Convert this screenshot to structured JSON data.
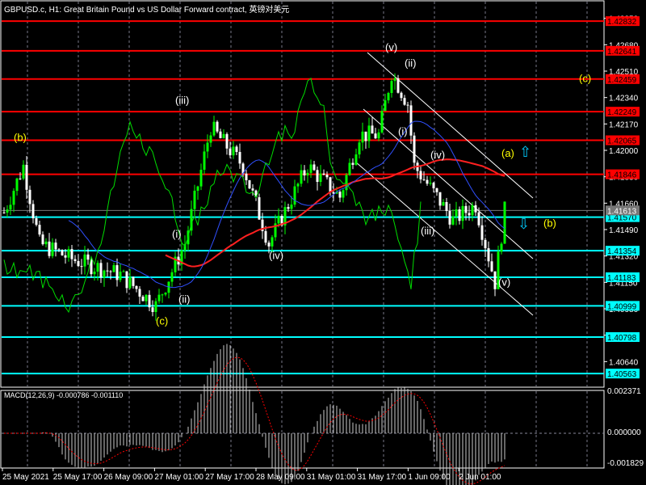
{
  "title": "GBPUSD.c, H1:  Great Britain Pound vs US Dollar Forward contract, 英镑对美元",
  "macd_label": "MACD(12,26,9) -0.000786 -0.001110",
  "colors": {
    "bull": "#00ff00",
    "bear": "#ffffff",
    "resistance": "#ff0000",
    "support": "#00ffff",
    "signal": "#ff0000"
  },
  "price_ticks": [
    "1.42850",
    "1.42680",
    "1.42510",
    "1.42340",
    "1.42170",
    "1.42000",
    "1.41830",
    "1.41660",
    "1.41490",
    "1.41320",
    "1.41150",
    "1.40980",
    "1.40810",
    "1.40640"
  ],
  "resistance_levels": [
    "1.42832",
    "1.42641",
    "1.42459",
    "1.42249",
    "1.42065",
    "1.41846"
  ],
  "support_levels": [
    "1.41570",
    "1.41354",
    "1.41183",
    "1.40999",
    "1.40798",
    "1.40563"
  ],
  "current_price": "1.41613",
  "macd_ticks": [
    "0.002371",
    "0.000000",
    "-0.001829"
  ],
  "time_labels": [
    "25 May 2021",
    "25 May 17:00",
    "26 May 09:00",
    "27 May 01:00",
    "27 May 17:00",
    "28 May 09:00",
    "31 May 01:00",
    "31 May 17:00",
    "1 Jun 09:00",
    "2 Jun 01:00"
  ],
  "wave_labels": [
    {
      "text": "(b)",
      "color": "#ffff00",
      "price": 1.4208,
      "slot": 5
    },
    {
      "text": "(iii)",
      "color": "#ffffff",
      "price": 1.4232,
      "slot": 55
    },
    {
      "text": "(i)",
      "color": "#ffffff",
      "price": 1.4146,
      "slot": 54
    },
    {
      "text": "(ii)",
      "color": "#ffffff",
      "price": 1.4104,
      "slot": 56
    },
    {
      "text": "(c)",
      "color": "#ffff00",
      "price": 1.409,
      "slot": 49
    },
    {
      "text": "(iv)",
      "color": "#ffffff",
      "price": 1.4132,
      "slot": 84
    },
    {
      "text": "(v)",
      "color": "#ffffff",
      "price": 1.4266,
      "slot": 120
    },
    {
      "text": "(ii)",
      "color": "#ffffff",
      "price": 1.4256,
      "slot": 126
    },
    {
      "text": "(i)",
      "color": "#ffffff",
      "price": 1.4212,
      "slot": 124
    },
    {
      "text": "(iv)",
      "color": "#ffffff",
      "price": 1.4197,
      "slot": 134
    },
    {
      "text": "(iii)",
      "color": "#ffffff",
      "price": 1.4148,
      "slot": 131
    },
    {
      "text": "(v)",
      "color": "#ffffff",
      "price": 1.4115,
      "slot": 155
    },
    {
      "text": "(a)",
      "color": "#ffff00",
      "price": 1.4198,
      "slot": 156
    },
    {
      "text": "(b)",
      "color": "#ffff00",
      "price": 1.4153,
      "slot": 169
    },
    {
      "text": "(c)",
      "color": "#ffff00",
      "price": 1.4246,
      "slot": 180
    }
  ]
}
